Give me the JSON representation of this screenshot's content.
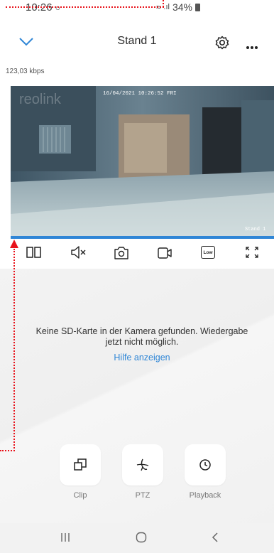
{
  "status": {
    "time": "10:26",
    "battery": "34%"
  },
  "header": {
    "title": "Stand 1"
  },
  "stream": {
    "bitrate": "123,03 kbps",
    "overlay_timestamp": "16/04/2021 10:26:52 FRI",
    "overlay_watermark": "reolink",
    "overlay_camera_name": "Stand 1"
  },
  "controls": {
    "quality_label": "Low"
  },
  "message": {
    "text": "Keine SD-Karte in der Kamera gefunden. Wiedergabe jetzt nicht möglich.",
    "help_link": "Hilfe anzeigen"
  },
  "actions": [
    {
      "label": "Clip"
    },
    {
      "label": "PTZ"
    },
    {
      "label": "Playback"
    }
  ],
  "colors": {
    "accent": "#2f86d6",
    "annotation": "#e8131b"
  }
}
